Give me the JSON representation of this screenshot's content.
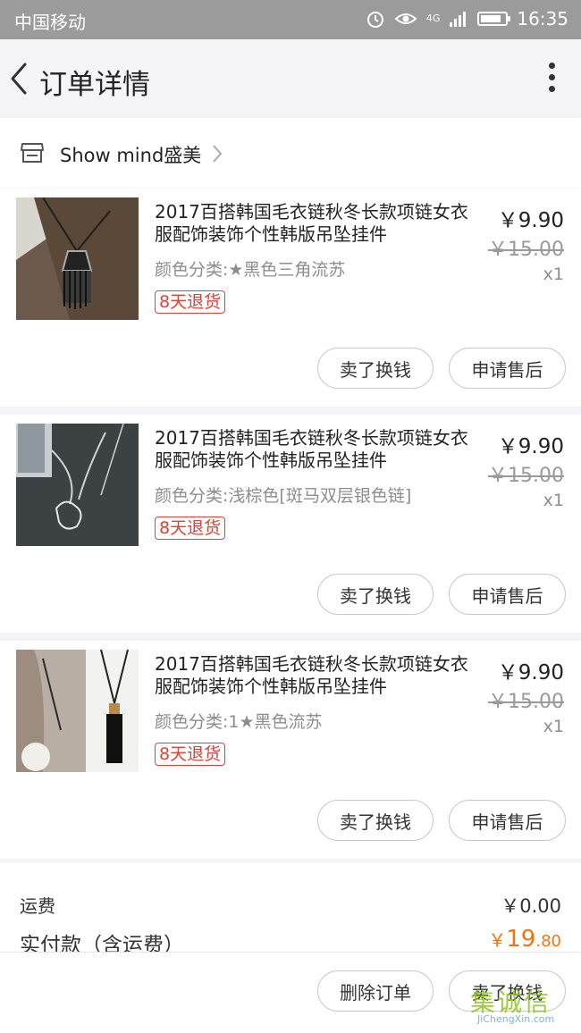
{
  "status_bar": {
    "carrier": "中国移动",
    "network": "4G",
    "time": "16:35"
  },
  "header": {
    "title": "订单详情"
  },
  "shop": {
    "name": "Show mind盛美"
  },
  "items": [
    {
      "title": "2017百搭韩国毛衣链秋冬长款项链女衣服配饰装饰个性韩版吊坠挂件",
      "sku": "颜色分类:★黑色三角流苏",
      "tag": "8天退货",
      "price": "￥9.90",
      "original_price": "￥15.00",
      "quantity": "x1",
      "sell_button": "卖了换钱",
      "after_sale_button": "申请售后"
    },
    {
      "title": "2017百搭韩国毛衣链秋冬长款项链女衣服配饰装饰个性韩版吊坠挂件",
      "sku": "颜色分类:浅棕色[斑马双层银色链]",
      "tag": "8天退货",
      "price": "￥9.90",
      "original_price": "￥15.00",
      "quantity": "x1",
      "sell_button": "卖了换钱",
      "after_sale_button": "申请售后"
    },
    {
      "title": "2017百搭韩国毛衣链秋冬长款项链女衣服配饰装饰个性韩版吊坠挂件",
      "sku": "颜色分类:1★黑色流苏",
      "tag": "8天退货",
      "price": "￥9.90",
      "original_price": "￥15.00",
      "quantity": "x1",
      "sell_button": "卖了换钱",
      "after_sale_button": "申请售后"
    }
  ],
  "summary": {
    "shipping_label": "运费",
    "shipping_value": "￥0.00",
    "paid_label": "实付款（含运费）",
    "paid_currency": "￥",
    "paid_integer": "19",
    "paid_decimal": ".80"
  },
  "footer": {
    "delete_button": "删除订单",
    "sell_button": "卖了换钱"
  },
  "watermark": {
    "logo": "集诚信",
    "url": "JiChengXin.com"
  },
  "colors": {
    "status_bar": "#9b9b9b",
    "accent_price": "#f07416",
    "tag_red": "#d9433a",
    "background": "#f5f4f8"
  }
}
